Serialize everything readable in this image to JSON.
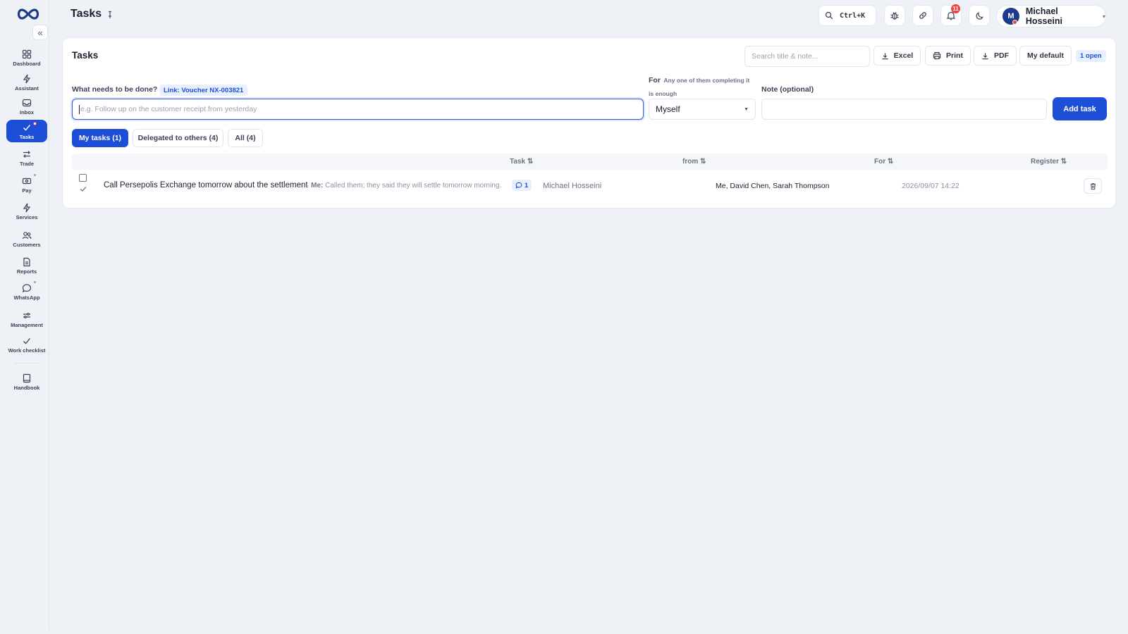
{
  "sidebar": {
    "collapse_glyph": "«",
    "items": [
      {
        "label": "Dashboard",
        "icon": "grid-icon"
      },
      {
        "label": "Assistant",
        "icon": "bolt-icon"
      },
      {
        "label": "Inbox",
        "icon": "inbox-icon"
      },
      {
        "label": "Tasks",
        "icon": "check-icon",
        "active": true
      },
      {
        "label": "Trade",
        "icon": "swap-icon"
      },
      {
        "label": "Pay",
        "icon": "cash-icon"
      },
      {
        "label": "Services",
        "icon": "bolt-icon"
      },
      {
        "label": "Customers",
        "icon": "users-icon"
      },
      {
        "label": "Reports",
        "icon": "document-icon"
      },
      {
        "label": "WhatsApp",
        "icon": "chat-icon"
      },
      {
        "label": "Management",
        "icon": "sliders-icon"
      },
      {
        "label": "Work checklist",
        "icon": "check-icon"
      },
      {
        "label": "Handbook",
        "icon": "book-icon"
      }
    ]
  },
  "header": {
    "title": "Tasks",
    "search_shortcut": "Ctrl+K",
    "notification_count": "11",
    "user": {
      "initial": "M",
      "name": "Michael Hosseini",
      "caret": "▾"
    }
  },
  "card": {
    "title": "Tasks",
    "search_placeholder": "Search title & note...",
    "toolbar": {
      "excel": "Excel",
      "print": "Print",
      "pdf": "PDF",
      "my_default": "My default"
    },
    "open_count": "1 open"
  },
  "form": {
    "task_label": "What needs to be done?",
    "link_chip": "Link: Voucher NX-003821",
    "task_placeholder": "e.g. Follow up on the customer receipt from yesterday",
    "for_label": "For",
    "for_hint": "Any one of them completing it is enough",
    "for_value": "Myself",
    "note_label": "Note (optional)",
    "add_button": "Add task"
  },
  "tabs": [
    {
      "label": "My tasks (1)",
      "active": true
    },
    {
      "label": "Delegated to others (4)",
      "active": false
    },
    {
      "label": "All (4)",
      "active": false
    }
  ],
  "table": {
    "columns": {
      "task": "Task ⇅",
      "from": "from ⇅",
      "for": "For ⇅",
      "register": "Register ⇅"
    },
    "rows": [
      {
        "title": "Call Persepolis Exchange tomorrow about the settlement",
        "note_sep": "·",
        "note_prefix": "Me:",
        "note_text": "Called them; they said they will settle tomorrow morning.",
        "comments": "1",
        "from": "Michael Hosseini",
        "for": "Me, David Chen, Sarah Thompson",
        "registered": "2026/09/07 14:22"
      }
    ]
  },
  "colors": {
    "accent": "#1d4ed8",
    "badge": "#ef4444",
    "background": "#eef1f6"
  }
}
